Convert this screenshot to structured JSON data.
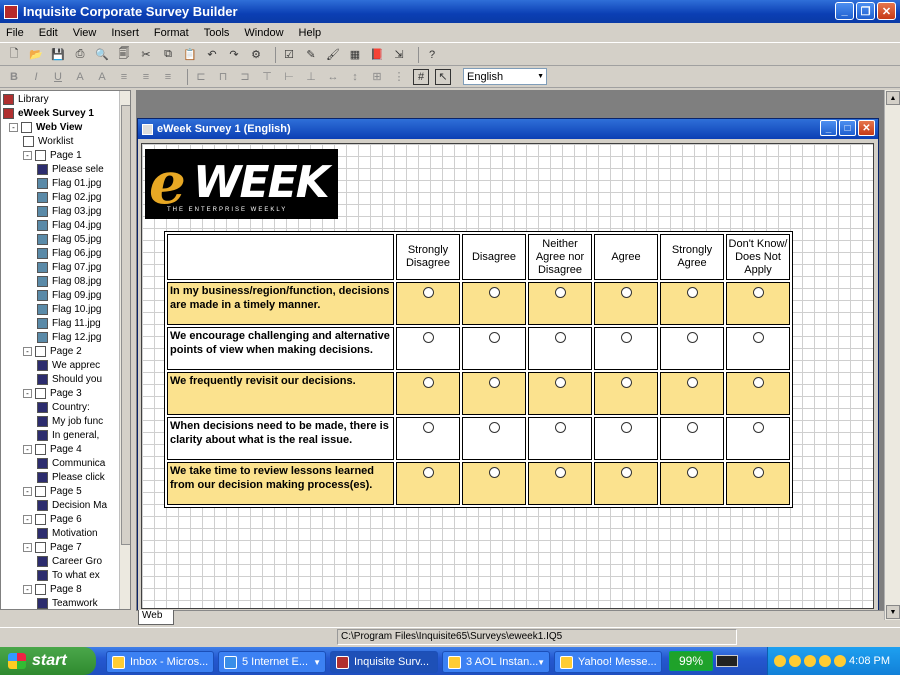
{
  "window": {
    "title": "Inquisite Corporate Survey Builder"
  },
  "menu": [
    "File",
    "Edit",
    "View",
    "Insert",
    "Format",
    "Tools",
    "Window",
    "Help"
  ],
  "toolbar": {
    "language": "English"
  },
  "tree": [
    {
      "label": "Library",
      "level": 0,
      "icon": "book",
      "pm": ""
    },
    {
      "label": "eWeek Survey 1",
      "level": 0,
      "icon": "book",
      "pm": "",
      "bold": true
    },
    {
      "label": "Web View",
      "level": 1,
      "icon": "page",
      "pm": "-",
      "bold": true
    },
    {
      "label": "Worklist",
      "level": 2,
      "icon": "page",
      "pm": ""
    },
    {
      "label": "Page 1",
      "level": 2,
      "icon": "page",
      "pm": "-"
    },
    {
      "label": "Please sele",
      "level": 3,
      "icon": "q",
      "pm": ""
    },
    {
      "label": "Flag 01.jpg",
      "level": 3,
      "icon": "img",
      "pm": ""
    },
    {
      "label": "Flag 02.jpg",
      "level": 3,
      "icon": "img",
      "pm": ""
    },
    {
      "label": "Flag 03.jpg",
      "level": 3,
      "icon": "img",
      "pm": ""
    },
    {
      "label": "Flag 04.jpg",
      "level": 3,
      "icon": "img",
      "pm": ""
    },
    {
      "label": "Flag 05.jpg",
      "level": 3,
      "icon": "img",
      "pm": ""
    },
    {
      "label": "Flag 06.jpg",
      "level": 3,
      "icon": "img",
      "pm": ""
    },
    {
      "label": "Flag 07.jpg",
      "level": 3,
      "icon": "img",
      "pm": ""
    },
    {
      "label": "Flag 08.jpg",
      "level": 3,
      "icon": "img",
      "pm": ""
    },
    {
      "label": "Flag 09.jpg",
      "level": 3,
      "icon": "img",
      "pm": ""
    },
    {
      "label": "Flag 10.jpg",
      "level": 3,
      "icon": "img",
      "pm": ""
    },
    {
      "label": "Flag 11.jpg",
      "level": 3,
      "icon": "img",
      "pm": ""
    },
    {
      "label": "Flag 12.jpg",
      "level": 3,
      "icon": "img",
      "pm": ""
    },
    {
      "label": "Page 2",
      "level": 2,
      "icon": "page",
      "pm": "-"
    },
    {
      "label": "We apprec",
      "level": 3,
      "icon": "q",
      "pm": ""
    },
    {
      "label": "Should you",
      "level": 3,
      "icon": "q",
      "pm": ""
    },
    {
      "label": "Page 3",
      "level": 2,
      "icon": "page",
      "pm": "-"
    },
    {
      "label": "Country:",
      "level": 3,
      "icon": "q",
      "pm": ""
    },
    {
      "label": "My job func",
      "level": 3,
      "icon": "q",
      "pm": ""
    },
    {
      "label": "In general,",
      "level": 3,
      "icon": "q",
      "pm": ""
    },
    {
      "label": "Page 4",
      "level": 2,
      "icon": "page",
      "pm": "-"
    },
    {
      "label": "Communica",
      "level": 3,
      "icon": "q",
      "pm": ""
    },
    {
      "label": "Please click",
      "level": 3,
      "icon": "q",
      "pm": ""
    },
    {
      "label": "Page 5",
      "level": 2,
      "icon": "page",
      "pm": "-"
    },
    {
      "label": "Decision Ma",
      "level": 3,
      "icon": "q",
      "pm": ""
    },
    {
      "label": "Page 6",
      "level": 2,
      "icon": "page",
      "pm": "-"
    },
    {
      "label": "Motivation",
      "level": 3,
      "icon": "q",
      "pm": ""
    },
    {
      "label": "Page 7",
      "level": 2,
      "icon": "page",
      "pm": "-"
    },
    {
      "label": "Career Gro",
      "level": 3,
      "icon": "q",
      "pm": ""
    },
    {
      "label": "To what ex",
      "level": 3,
      "icon": "q",
      "pm": ""
    },
    {
      "label": "Page 8",
      "level": 2,
      "icon": "page",
      "pm": "-"
    },
    {
      "label": "Teamwork",
      "level": 3,
      "icon": "q",
      "pm": ""
    }
  ],
  "doc": {
    "title": "eWeek Survey 1  (English)"
  },
  "logo": {
    "e": "e",
    "week": "WEEK",
    "tagline": "THE ENTERPRISE WEEKLY"
  },
  "survey": {
    "columns": [
      {
        "line1": "Strongly",
        "line2": "Disagree",
        "line3": ""
      },
      {
        "line1": "Disagree",
        "line2": "",
        "line3": ""
      },
      {
        "line1": "Neither",
        "line2": "Agree nor",
        "line3": "Disagree"
      },
      {
        "line1": "Agree",
        "line2": "",
        "line3": ""
      },
      {
        "line1": "Strongly",
        "line2": "Agree",
        "line3": ""
      },
      {
        "line1": "Don't Know/",
        "line2": "Does Not",
        "line3": "Apply"
      }
    ],
    "questions": [
      "In my business/region/function, decisions are made in a timely manner.",
      "We encourage challenging and alternative points of view when making decisions.",
      "We frequently revisit our decisions.",
      "When decisions need to be made, there is clarity about what is the real issue.",
      "We take time to review lessons learned from our decision making process(es)."
    ],
    "row_colors": [
      "#fbe28e",
      "#ffffff",
      "#fbe28e",
      "#ffffff",
      "#fbe28e"
    ]
  },
  "tab": {
    "label": "Web"
  },
  "status": {
    "path": "C:\\Program Files\\Inquisite65\\Surveys\\eweek1.IQ5"
  },
  "taskbar": {
    "start": "start",
    "tasks": [
      "Inbox - Micros...",
      "5 Internet E...",
      "Inquisite Surv...",
      "3 AOL Instan...",
      "Yahoo! Messe..."
    ],
    "battery": "99%",
    "clock": "4:08 PM"
  }
}
